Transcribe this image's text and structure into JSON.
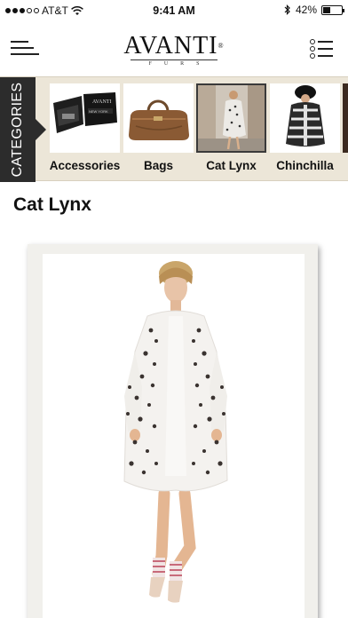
{
  "status": {
    "carrier": "AT&T",
    "time": "9:41 AM",
    "battery": "42%",
    "battery_level": 0.42,
    "signal_bars_filled": 3,
    "signal_bars_total": 5,
    "icons": [
      "wifi-icon",
      "bluetooth-icon",
      "battery-icon"
    ]
  },
  "header": {
    "logo_text": "AVANTI",
    "logo_mark": "®",
    "logo_sub": "FURS",
    "menu_icon": "hamburger-menu-icon",
    "list_icon": "list-view-icon"
  },
  "categories": {
    "tab_label": "CATEGORIES",
    "items": [
      {
        "label": "Accessories",
        "selected": false,
        "thumb": "accessories-box-image"
      },
      {
        "label": "Bags",
        "selected": false,
        "thumb": "fur-handbag-image"
      },
      {
        "label": "Cat Lynx",
        "selected": true,
        "thumb": "cat-lynx-coat-model-image"
      },
      {
        "label": "Chinchilla",
        "selected": false,
        "thumb": "chinchilla-coat-image"
      }
    ]
  },
  "page": {
    "title": "Cat Lynx"
  },
  "product": {
    "image": "cat-lynx-fur-coat-model-photo"
  },
  "colors": {
    "strip_bg": "#ece6d8",
    "tab_bg": "#2c2c2c",
    "card_bg": "#f1f0ec",
    "text": "#111111"
  }
}
